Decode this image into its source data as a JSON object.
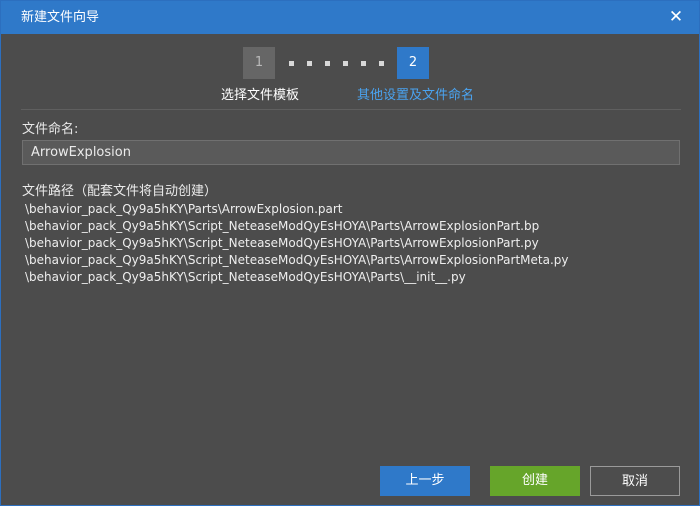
{
  "window": {
    "title": "新建文件向导",
    "close_icon": "close-icon"
  },
  "stepper": {
    "steps": [
      {
        "number": "1",
        "label": "选择文件模板",
        "active": false
      },
      {
        "number": "2",
        "label": "其他设置及文件命名",
        "active": true
      }
    ]
  },
  "form": {
    "name_label": "文件命名:",
    "name_value": "ArrowExplosion",
    "path_label": "文件路径（配套文件将自动创建）",
    "paths": [
      "\\behavior_pack_Qy9a5hKY\\Parts\\ArrowExplosion.part",
      "\\behavior_pack_Qy9a5hKY\\Script_NeteaseModQyEsHOYA\\Parts\\ArrowExplosionPart.bp",
      "\\behavior_pack_Qy9a5hKY\\Script_NeteaseModQyEsHOYA\\Parts\\ArrowExplosionPart.py",
      "\\behavior_pack_Qy9a5hKY\\Script_NeteaseModQyEsHOYA\\Parts\\ArrowExplosionPartMeta.py",
      "\\behavior_pack_Qy9a5hKY\\Script_NeteaseModQyEsHOYA\\Parts\\__init__.py"
    ]
  },
  "buttons": {
    "prev": "上一步",
    "create": "创建",
    "cancel": "取消"
  },
  "colors": {
    "accent": "#2f79c9",
    "create": "#66a52a",
    "active_step_label": "#4aa3f0"
  }
}
